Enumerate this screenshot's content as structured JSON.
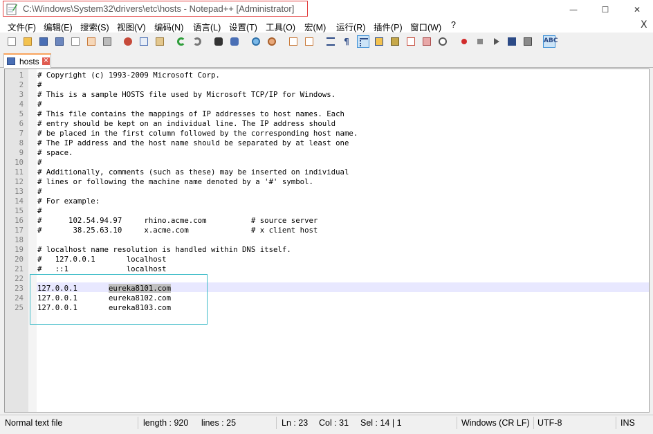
{
  "window": {
    "title": "C:\\Windows\\System32\\drivers\\etc\\hosts - Notepad++ [Administrator]",
    "minimize": "—",
    "maximize": "☐",
    "close": "✕",
    "menu_close": "X"
  },
  "menu": [
    "文件(F)",
    "编辑(E)",
    "搜索(S)",
    "视图(V)",
    "编码(N)",
    "语言(L)",
    "设置(T)",
    "工具(O)",
    "宏(M)",
    "运行(R)",
    "插件(P)",
    "窗口(W)",
    "?"
  ],
  "toolbar": {
    "icons": [
      "new-file-icon",
      "open-file-icon",
      "save-icon",
      "save-all-icon",
      "close-icon",
      "close-all-icon",
      "print-icon",
      "cut-icon",
      "copy-icon",
      "paste-icon",
      "undo-icon",
      "redo-icon",
      "find-icon",
      "replace-icon",
      "zoom-in-icon",
      "zoom-out-icon",
      "sync-vertical-icon",
      "sync-horizontal-icon",
      "word-wrap-icon",
      "show-all-chars-icon",
      "indent-guide-icon",
      "user-lang-icon",
      "doc-map-icon",
      "function-list-icon",
      "folder-workspace-icon",
      "monitoring-icon",
      "record-macro-icon",
      "stop-macro-icon",
      "play-macro-icon",
      "run-macro-multiple-icon",
      "save-macro-icon",
      "spell-check-icon"
    ],
    "spell_label": "ABC"
  },
  "tab": {
    "label": "hosts",
    "close": "✕"
  },
  "editor": {
    "lines": [
      "# Copyright (c) 1993-2009 Microsoft Corp.",
      "#",
      "# This is a sample HOSTS file used by Microsoft TCP/IP for Windows.",
      "#",
      "# This file contains the mappings of IP addresses to host names. Each",
      "# entry should be kept on an individual line. The IP address should",
      "# be placed in the first column followed by the corresponding host name.",
      "# The IP address and the host name should be separated by at least one",
      "# space.",
      "#",
      "# Additionally, comments (such as these) may be inserted on individual",
      "# lines or following the machine name denoted by a '#' symbol.",
      "#",
      "# For example:",
      "#",
      "#      102.54.94.97     rhino.acme.com          # source server",
      "#       38.25.63.10     x.acme.com              # x client host",
      "",
      "# localhost name resolution is handled within DNS itself.",
      "#   127.0.0.1       localhost",
      "#   ::1             localhost",
      "",
      "127.0.0.1       eureka8101.com",
      "127.0.0.1       eureka8102.com",
      "127.0.0.1       eureka8103.com"
    ],
    "current_line": 23
  },
  "status": {
    "file_type": "Normal text file",
    "length": "length : 920",
    "lines": "lines : 25",
    "ln": "Ln : 23",
    "col": "Col : 31",
    "sel": "Sel : 14 | 1",
    "eol": "Windows (CR LF)",
    "encoding": "UTF-8",
    "mode": "INS"
  }
}
